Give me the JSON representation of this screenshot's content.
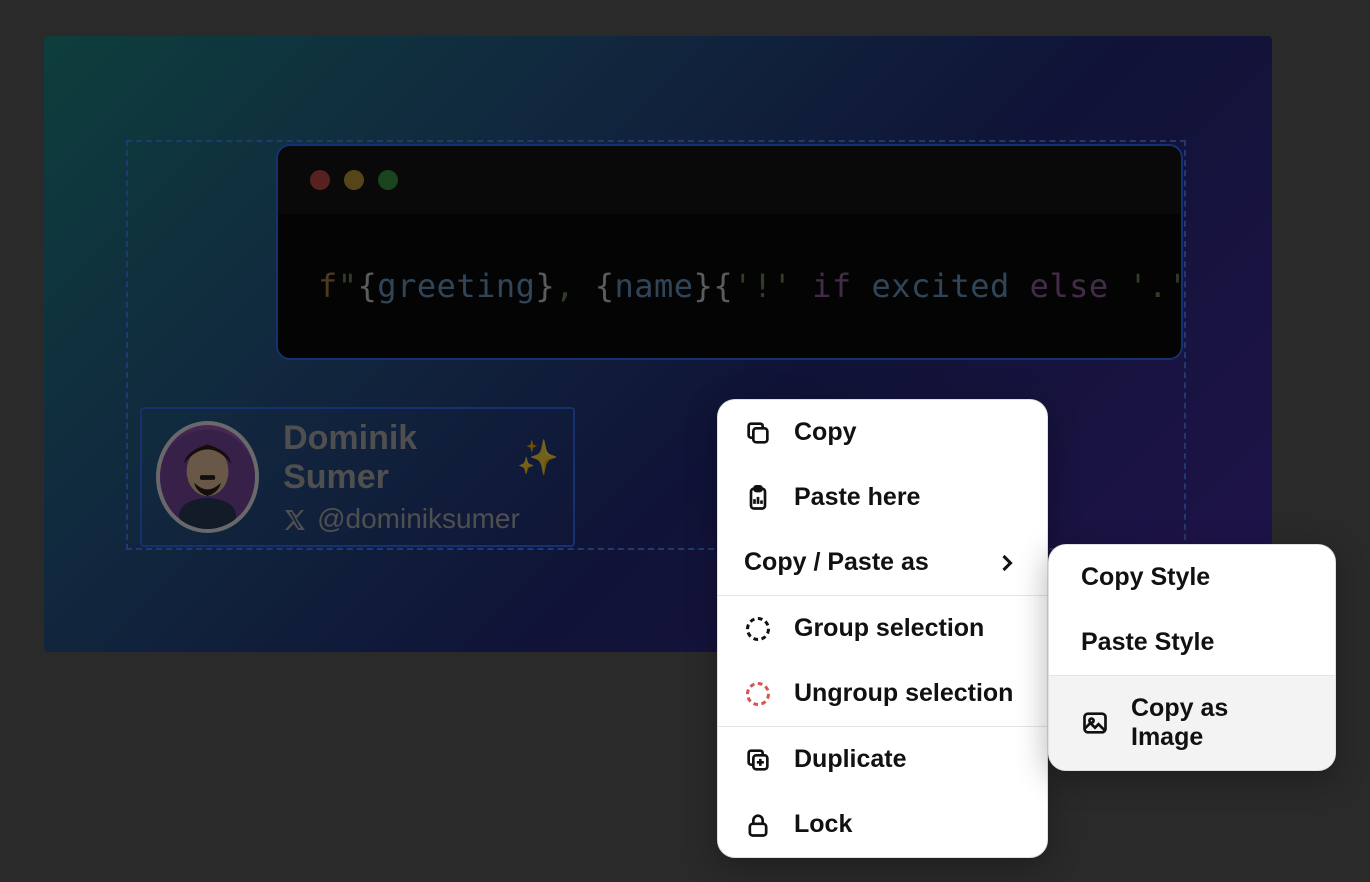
{
  "code": {
    "tokens": {
      "f": "f",
      "q1": "\"",
      "ob1": "{",
      "greeting": "greeting",
      "cb1": "}",
      "comma": ", ",
      "ob2": "{",
      "name": "name",
      "cb2": "}",
      "ob3": "{",
      "excl": "'!' ",
      "if": "if ",
      "excited": "excited ",
      "else": "else ",
      "dot": "'.'",
      "cb3": "}",
      "q2": "\""
    }
  },
  "author": {
    "name": "Dominik Sumer",
    "emoji": "✨",
    "handle": "@dominiksumer"
  },
  "menu": {
    "copy": "Copy",
    "paste_here": "Paste here",
    "copy_paste_as": "Copy / Paste as",
    "group": "Group selection",
    "ungroup": "Ungroup selection",
    "duplicate": "Duplicate",
    "lock": "Lock"
  },
  "submenu": {
    "copy_style": "Copy Style",
    "paste_style": "Paste Style",
    "copy_as_image": "Copy as Image"
  }
}
